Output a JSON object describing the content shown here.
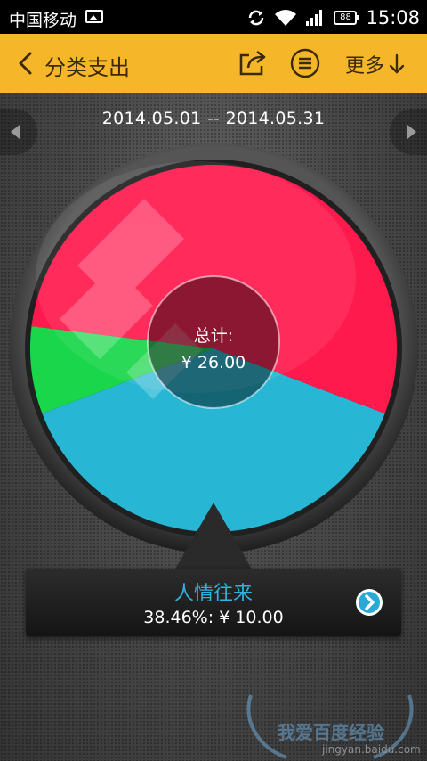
{
  "status_bar": {
    "carrier": "中国移动",
    "battery": "88",
    "time": "15:08"
  },
  "action_bar": {
    "title": "分类支出",
    "more_label": "更多"
  },
  "date_range": "2014.05.01 -- 2014.05.31",
  "summary": {
    "total_label": "总计:",
    "total_value": "¥ 26.00"
  },
  "chart_data": {
    "type": "pie",
    "title": "",
    "slices": [
      {
        "value": 10.0,
        "percent": 38.46,
        "color": "#27b7d4",
        "selected": true
      },
      {
        "value": 2.0,
        "color": "#19d64a"
      },
      {
        "value": 14.0,
        "color": "#ff1a4e"
      }
    ]
  },
  "selected": {
    "category": "人情往来",
    "detail": "38.46%: ¥ 10.00"
  },
  "watermark": {
    "text": "我爱百度经验",
    "url": "jingyan.baidu.com"
  },
  "colors": {
    "accent": "#f6b62a",
    "selected_text": "#2fb3e0"
  }
}
